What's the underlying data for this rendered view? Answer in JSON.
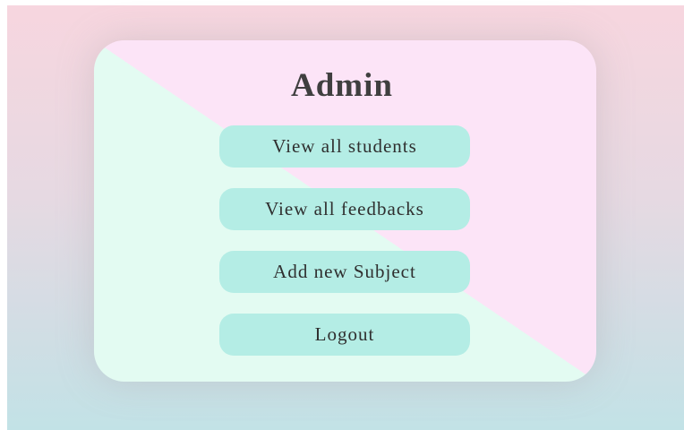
{
  "page": {
    "title": "Admin"
  },
  "menu": {
    "buttons": [
      {
        "label": "View all students"
      },
      {
        "label": "View all feedbacks"
      },
      {
        "label": "Add new Subject"
      },
      {
        "label": "Logout"
      }
    ]
  },
  "colors": {
    "button_bg": "#b4ede5",
    "card_left": "#e3fbf2",
    "card_right": "#fce4f7",
    "bg_top": "#f7d6df",
    "bg_bottom": "#c2e2e6",
    "text": "#3f3f3f"
  }
}
